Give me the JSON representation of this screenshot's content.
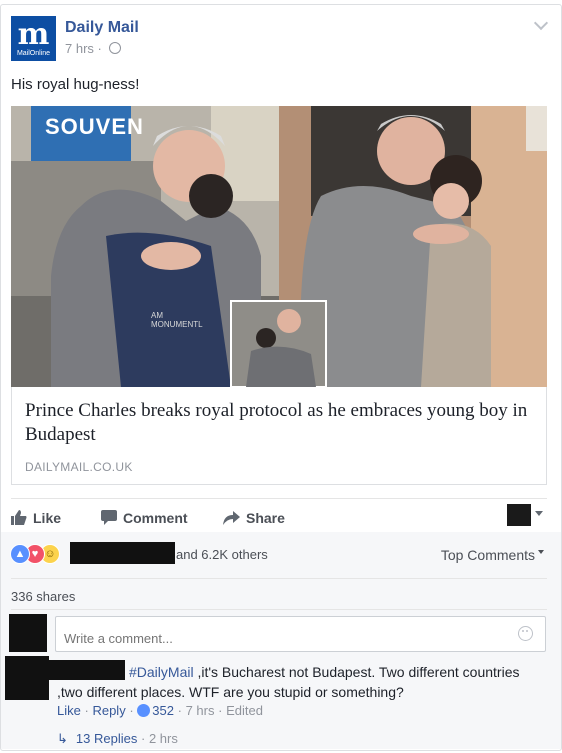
{
  "post": {
    "page_name": "Daily Mail",
    "page_logo_letter": "m",
    "page_logo_sub": "MailOnline",
    "time": "7 hrs",
    "meta_sep": "·",
    "text": "His royal hug-ness!",
    "photo_sign": "SOUVEN",
    "photo_shirt": "AM MONUMENTL"
  },
  "link": {
    "title": "Prince Charles breaks royal protocol as he embraces young boy in Budapest",
    "domain": "DAILYMAIL.CO.UK"
  },
  "actions": {
    "like": "Like",
    "comment": "Comment",
    "share": "Share"
  },
  "reactions": {
    "others": "and 6.2K others",
    "top_comments": "Top Comments",
    "shares": "336 shares",
    "colors": {
      "like": "#5890ff",
      "love": "#f25268",
      "haha": "#fcd34d"
    }
  },
  "comment_input": {
    "placeholder": "Write a comment..."
  },
  "comment": {
    "tag": "#DailyMail",
    "text": " ,it's Bucharest not Budapest. Two different countries ,two different places. WTF are you stupid or something?",
    "like": "Like",
    "reply": "Reply",
    "likes": "352",
    "time": "7 hrs",
    "edited": "Edited",
    "sep": "·"
  },
  "replies": {
    "label": "13 Replies",
    "time": "2 hrs",
    "sep": "·"
  }
}
